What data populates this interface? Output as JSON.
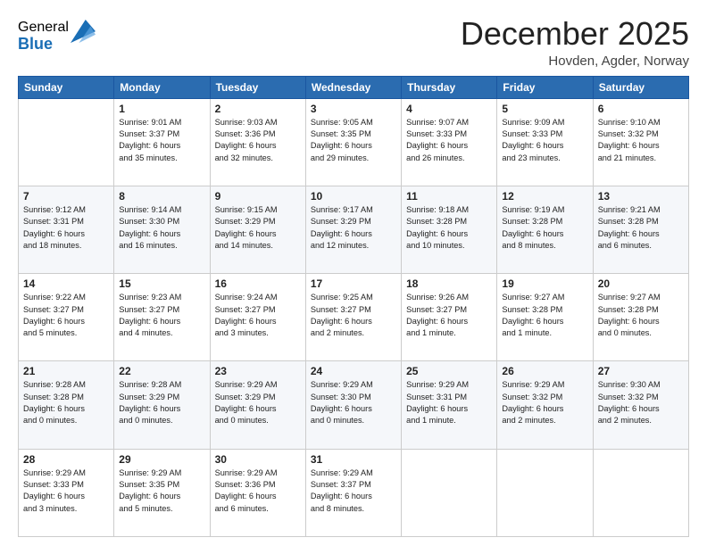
{
  "logo": {
    "general": "General",
    "blue": "Blue"
  },
  "header": {
    "month": "December 2025",
    "location": "Hovden, Agder, Norway"
  },
  "weekdays": [
    "Sunday",
    "Monday",
    "Tuesday",
    "Wednesday",
    "Thursday",
    "Friday",
    "Saturday"
  ],
  "weeks": [
    [
      {
        "day": "",
        "info": ""
      },
      {
        "day": "1",
        "info": "Sunrise: 9:01 AM\nSunset: 3:37 PM\nDaylight: 6 hours\nand 35 minutes."
      },
      {
        "day": "2",
        "info": "Sunrise: 9:03 AM\nSunset: 3:36 PM\nDaylight: 6 hours\nand 32 minutes."
      },
      {
        "day": "3",
        "info": "Sunrise: 9:05 AM\nSunset: 3:35 PM\nDaylight: 6 hours\nand 29 minutes."
      },
      {
        "day": "4",
        "info": "Sunrise: 9:07 AM\nSunset: 3:33 PM\nDaylight: 6 hours\nand 26 minutes."
      },
      {
        "day": "5",
        "info": "Sunrise: 9:09 AM\nSunset: 3:33 PM\nDaylight: 6 hours\nand 23 minutes."
      },
      {
        "day": "6",
        "info": "Sunrise: 9:10 AM\nSunset: 3:32 PM\nDaylight: 6 hours\nand 21 minutes."
      }
    ],
    [
      {
        "day": "7",
        "info": "Sunrise: 9:12 AM\nSunset: 3:31 PM\nDaylight: 6 hours\nand 18 minutes."
      },
      {
        "day": "8",
        "info": "Sunrise: 9:14 AM\nSunset: 3:30 PM\nDaylight: 6 hours\nand 16 minutes."
      },
      {
        "day": "9",
        "info": "Sunrise: 9:15 AM\nSunset: 3:29 PM\nDaylight: 6 hours\nand 14 minutes."
      },
      {
        "day": "10",
        "info": "Sunrise: 9:17 AM\nSunset: 3:29 PM\nDaylight: 6 hours\nand 12 minutes."
      },
      {
        "day": "11",
        "info": "Sunrise: 9:18 AM\nSunset: 3:28 PM\nDaylight: 6 hours\nand 10 minutes."
      },
      {
        "day": "12",
        "info": "Sunrise: 9:19 AM\nSunset: 3:28 PM\nDaylight: 6 hours\nand 8 minutes."
      },
      {
        "day": "13",
        "info": "Sunrise: 9:21 AM\nSunset: 3:28 PM\nDaylight: 6 hours\nand 6 minutes."
      }
    ],
    [
      {
        "day": "14",
        "info": "Sunrise: 9:22 AM\nSunset: 3:27 PM\nDaylight: 6 hours\nand 5 minutes."
      },
      {
        "day": "15",
        "info": "Sunrise: 9:23 AM\nSunset: 3:27 PM\nDaylight: 6 hours\nand 4 minutes."
      },
      {
        "day": "16",
        "info": "Sunrise: 9:24 AM\nSunset: 3:27 PM\nDaylight: 6 hours\nand 3 minutes."
      },
      {
        "day": "17",
        "info": "Sunrise: 9:25 AM\nSunset: 3:27 PM\nDaylight: 6 hours\nand 2 minutes."
      },
      {
        "day": "18",
        "info": "Sunrise: 9:26 AM\nSunset: 3:27 PM\nDaylight: 6 hours\nand 1 minute."
      },
      {
        "day": "19",
        "info": "Sunrise: 9:27 AM\nSunset: 3:28 PM\nDaylight: 6 hours\nand 1 minute."
      },
      {
        "day": "20",
        "info": "Sunrise: 9:27 AM\nSunset: 3:28 PM\nDaylight: 6 hours\nand 0 minutes."
      }
    ],
    [
      {
        "day": "21",
        "info": "Sunrise: 9:28 AM\nSunset: 3:28 PM\nDaylight: 6 hours\nand 0 minutes."
      },
      {
        "day": "22",
        "info": "Sunrise: 9:28 AM\nSunset: 3:29 PM\nDaylight: 6 hours\nand 0 minutes."
      },
      {
        "day": "23",
        "info": "Sunrise: 9:29 AM\nSunset: 3:29 PM\nDaylight: 6 hours\nand 0 minutes."
      },
      {
        "day": "24",
        "info": "Sunrise: 9:29 AM\nSunset: 3:30 PM\nDaylight: 6 hours\nand 0 minutes."
      },
      {
        "day": "25",
        "info": "Sunrise: 9:29 AM\nSunset: 3:31 PM\nDaylight: 6 hours\nand 1 minute."
      },
      {
        "day": "26",
        "info": "Sunrise: 9:29 AM\nSunset: 3:32 PM\nDaylight: 6 hours\nand 2 minutes."
      },
      {
        "day": "27",
        "info": "Sunrise: 9:30 AM\nSunset: 3:32 PM\nDaylight: 6 hours\nand 2 minutes."
      }
    ],
    [
      {
        "day": "28",
        "info": "Sunrise: 9:29 AM\nSunset: 3:33 PM\nDaylight: 6 hours\nand 3 minutes."
      },
      {
        "day": "29",
        "info": "Sunrise: 9:29 AM\nSunset: 3:35 PM\nDaylight: 6 hours\nand 5 minutes."
      },
      {
        "day": "30",
        "info": "Sunrise: 9:29 AM\nSunset: 3:36 PM\nDaylight: 6 hours\nand 6 minutes."
      },
      {
        "day": "31",
        "info": "Sunrise: 9:29 AM\nSunset: 3:37 PM\nDaylight: 6 hours\nand 8 minutes."
      },
      {
        "day": "",
        "info": ""
      },
      {
        "day": "",
        "info": ""
      },
      {
        "day": "",
        "info": ""
      }
    ]
  ]
}
